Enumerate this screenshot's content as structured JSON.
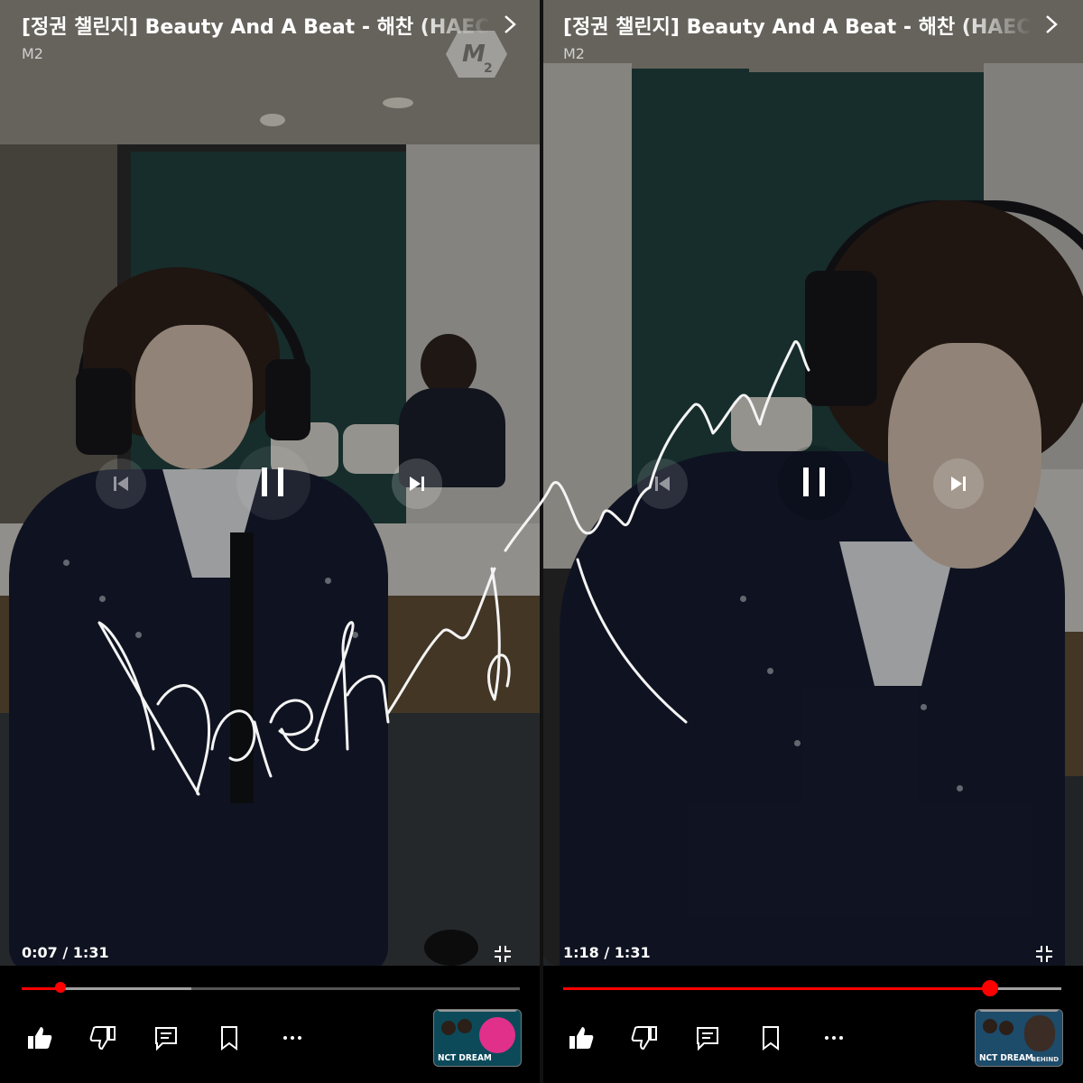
{
  "panels": [
    {
      "title": "[정권 챌린지] Beauty And A Beat - 해찬 (HAECHAN) #NCTDREAM #shorts",
      "channel": "M2",
      "current_time": "0:07",
      "duration": "1:31",
      "progress": 0.077,
      "buffered": 0.34,
      "controls": {
        "previous": "previous-icon",
        "play_state": "pause-icon",
        "next": "next-icon",
        "fullscreen": "exit-fullscreen-icon"
      },
      "actions": [
        "like-icon",
        "dislike-icon",
        "comment-icon",
        "save-icon",
        "more-icon"
      ],
      "shelf_thumbnail_label": "NCT DREAM"
    },
    {
      "title": "[정권 챌린지] Beauty And A Beat - 해찬 (HAECHAN) #NCTDREAM #shorts",
      "channel": "M2",
      "current_time": "1:18",
      "duration": "1:31",
      "progress": 0.857,
      "buffered": 1.0,
      "controls": {
        "previous": "previous-icon",
        "play_state": "pause-icon",
        "next": "next-icon",
        "fullscreen": "exit-fullscreen-icon"
      },
      "actions": [
        "like-icon",
        "dislike-icon",
        "comment-icon",
        "save-icon",
        "more-icon"
      ],
      "shelf_thumbnail_label": "NCT DREAM",
      "shelf_thumbnail_sublabel": "BEHIND"
    }
  ],
  "time_separator": " / ",
  "colors": {
    "accent": "#ff0000",
    "background": "#000000",
    "text": "#ffffff"
  },
  "watermark_signature": "haehyun"
}
